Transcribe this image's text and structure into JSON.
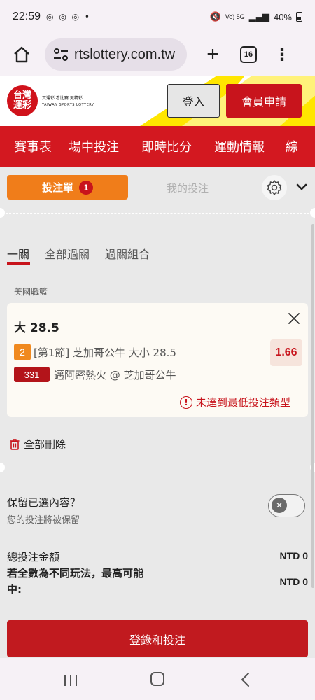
{
  "status_bar": {
    "time": "22:59",
    "network": "Vo) 5G",
    "battery": "40%"
  },
  "browser": {
    "url": "rtslottery.com.tw",
    "tab_count": "16"
  },
  "site": {
    "logo_main": "台灣運彩",
    "logo_zh": "買運彩  看比賽  更精彩",
    "logo_en": "TAIWAN SPORTS LOTTERY",
    "login_label": "登入",
    "register_label": "會員申請"
  },
  "nav": {
    "items": [
      "賽事表",
      "場中投注",
      "即時比分",
      "運動情報",
      "綜"
    ]
  },
  "slip": {
    "betslip_label": "投注單",
    "betslip_count": "1",
    "mybets_label": "我的投注",
    "sub_tabs": [
      "一關",
      "全部過關",
      "過關組合"
    ],
    "league": "美國職籃",
    "bet": {
      "title": "大 28.5",
      "period_no": "2",
      "description": "[第1節] 芝加哥公牛 大小 28.5",
      "odds": "1.66",
      "game_no": "331",
      "match": "邁阿密熱火 @ 芝加哥公牛",
      "warning": "未達到最低投注類型"
    },
    "delete_all_label": "全部刪除",
    "keep_title": "保留已選內容？",
    "keep_sub": "您的投注將被保留",
    "total_label": "總投注金額",
    "total_value": "NTD 0",
    "maxwin_label": "若全數為不同玩法，最高可能中:",
    "maxwin_value": "NTD 0",
    "submit_label": "登錄和投注"
  },
  "colors": {
    "brand_red": "#d31820",
    "accent_orange": "#f07d1a",
    "odds_red": "#c8141c"
  }
}
